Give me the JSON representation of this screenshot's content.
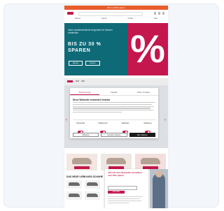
{
  "page": {
    "announcement": "Bis zu 30% sparen",
    "nav_items": [
      "Damen",
      "Herren",
      "Kinder",
      "Sale"
    ]
  },
  "hero": {
    "text": "Jetzt unwiderstehliche Angebote für Damen entdecken",
    "headline": "BIS ZU 30 %",
    "subheadline": "SPAREN",
    "button_1": "Damen",
    "button_2": "Herren",
    "percent_glyph": "%"
  },
  "consent": {
    "tabs": [
      "Zustimmung",
      "Details",
      "Über Cookies"
    ],
    "active_tab": "Zustimmung",
    "title": "Diese Webseite verwendet Cookies",
    "categories": [
      {
        "label": "Notwendig",
        "on": true
      },
      {
        "label": "Präferenzen",
        "on": true
      },
      {
        "label": "Statistiken",
        "on": true
      },
      {
        "label": "Marketing",
        "on": true
      }
    ],
    "buttons": {
      "deny": "Ablehnen",
      "allow_selection": "Auswahl erlauben",
      "allow_all": "Alle zulassen"
    }
  },
  "sections": {
    "new_arrivals_title": "DAS NEUE LIEBLINGS-SCHUHE"
  },
  "newsletter": {
    "title": "Jetzt für den Newsletter anmelden und 10% sparen",
    "submit": "Anmelden"
  },
  "colors": {
    "accent": "#c2164c",
    "hero_bg": "#0f6a78",
    "top_bar": "#e85d2a"
  }
}
